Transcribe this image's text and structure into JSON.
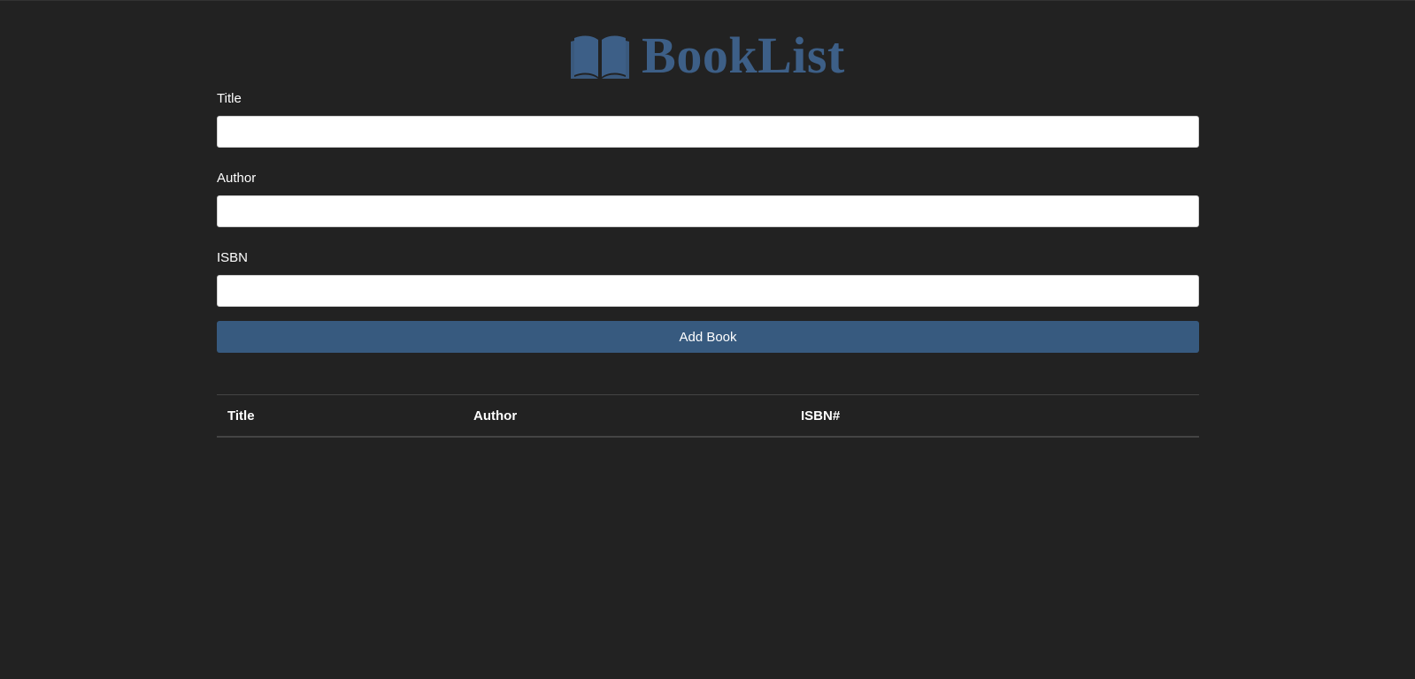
{
  "brand": {
    "title": "BookList",
    "icon": "book-open-icon",
    "color": "#3d5f87"
  },
  "form": {
    "title_label": "Title",
    "title_value": "",
    "author_label": "Author",
    "author_value": "",
    "isbn_label": "ISBN",
    "isbn_value": "",
    "submit_label": "Add Book",
    "submit_color": "#375a7f"
  },
  "table": {
    "headers": [
      "Title",
      "Author",
      "ISBN#"
    ],
    "rows": []
  },
  "colors": {
    "background": "#222222",
    "text": "#ffffff"
  }
}
